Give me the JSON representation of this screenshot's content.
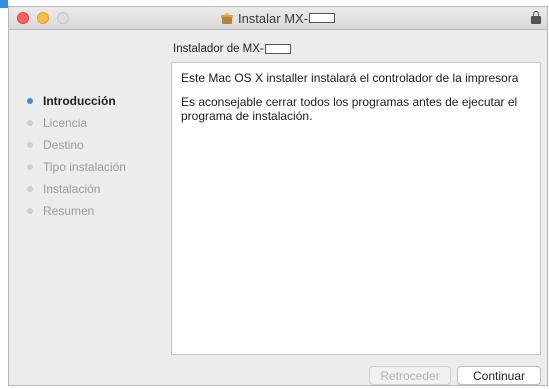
{
  "window": {
    "title": "Instalar MX-",
    "title_icon": "package-icon"
  },
  "sidebar": {
    "steps": [
      {
        "label": "Introducción",
        "state": "active"
      },
      {
        "label": "Licencia",
        "state": "pending"
      },
      {
        "label": "Destino",
        "state": "pending"
      },
      {
        "label": "Tipo instalación",
        "state": "pending"
      },
      {
        "label": "Instalación",
        "state": "pending"
      },
      {
        "label": "Resumen",
        "state": "pending"
      }
    ]
  },
  "main": {
    "heading": "Instalador de MX-",
    "paragraphs": [
      "Este Mac OS X installer instalará el controlador de la impresora",
      "Es aconsejable cerrar todos los programas antes de ejecutar el programa de instalación."
    ]
  },
  "buttons": {
    "back_label": "Retroceder",
    "back_enabled": false,
    "continue_label": "Continuar"
  },
  "colors": {
    "active_step": "#3b8fd9",
    "close": "#fc605b",
    "minimize": "#fdbc40"
  }
}
